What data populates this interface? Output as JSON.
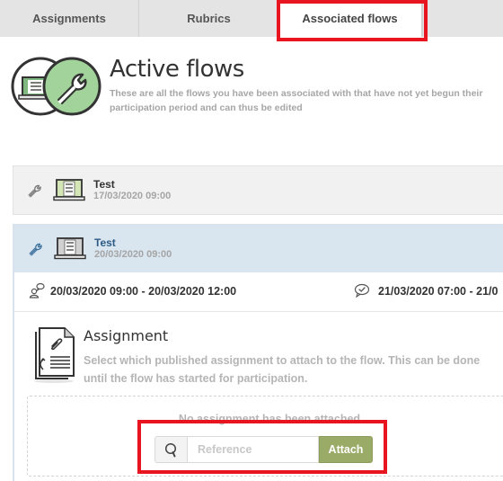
{
  "tabs": [
    {
      "label": "Assignments",
      "active": false
    },
    {
      "label": "Rubrics",
      "active": false
    },
    {
      "label": "Associated flows",
      "active": true
    }
  ],
  "header": {
    "title": "Active flows",
    "subtitle": "These are all the flows you have been associated with that have not yet begun their participation period and can thus be edited",
    "icon": "laptop-and-wrench-icon"
  },
  "flows": [
    {
      "name": "Test",
      "date": "17/03/2020 09:00",
      "expanded": false,
      "icons": [
        "wrench-icon",
        "laptop-checklist-icon"
      ]
    },
    {
      "name": "Test",
      "date": "20/03/2020 09:00",
      "expanded": true,
      "icons": [
        "wrench-icon",
        "laptop-checklist-icon"
      ],
      "periods": [
        {
          "icon": "participant-speech-icon",
          "range": "20/03/2020 09:00 - 20/03/2020 12:00"
        },
        {
          "icon": "review-check-bubble-icon",
          "range": "21/03/2020 07:00 - 21/0"
        }
      ],
      "assignment": {
        "title": "Assignment",
        "description": "Select which published assignment to attach to the flow. This can be done until the flow has started for participation.",
        "empty_text": "No assignment has been attached",
        "search_placeholder": "Reference",
        "search_value": "",
        "attach_label": "Attach"
      }
    }
  ],
  "colors": {
    "accent_green": "#9aab67",
    "expanded_header": "#d9e6f0",
    "highlight_red": "#e8141f",
    "flow_name_blue": "#2d5b86"
  }
}
